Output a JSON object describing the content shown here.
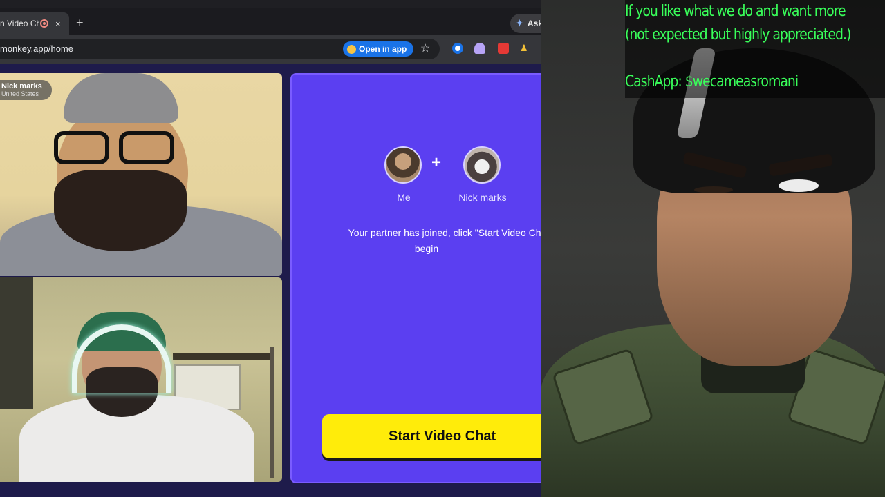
{
  "browser": {
    "tab": {
      "title": "n Video Ch",
      "close_glyph": "×"
    },
    "new_tab_glyph": "+",
    "ask_label": "Ask",
    "url": "monkey.app/home",
    "open_in_app_label": "Open in app",
    "star_glyph": "☆",
    "extensions": [
      "blue-circle-extension-icon",
      "ghost-extension-icon",
      "download-extension-icon",
      "figure-extension-icon"
    ]
  },
  "video_chat": {
    "partner_tag": {
      "name": "Nick marks",
      "country": "United States"
    },
    "match": {
      "plus": "+",
      "me_label": "Me",
      "partner_label": "Nick marks",
      "message": "Your partner has joined, click \"Start Video Cha",
      "message_line2": "begin",
      "button_label": "Start Video Chat"
    }
  },
  "overlay": {
    "line1": "If you like what we do and want more",
    "line2": "(not expected but highly appreciated.)",
    "line3": "CashApp: $wecameasromani"
  },
  "colors": {
    "panel_purple": "#5b3ff1",
    "button_yellow": "#ffec0a",
    "overlay_green": "#39ff5a",
    "open_in_app_blue": "#1a73e8"
  }
}
